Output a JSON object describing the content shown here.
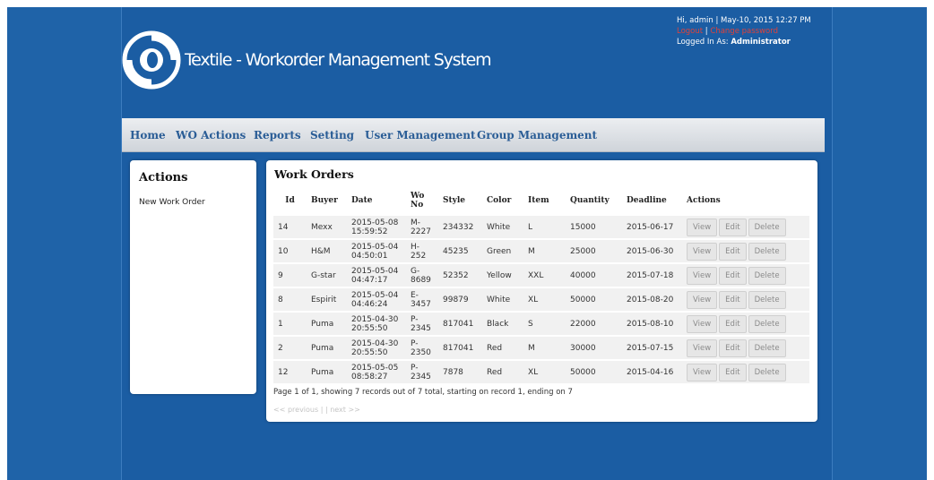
{
  "header": {
    "site_title": "Textile - Workorder Management System",
    "greeting": "Hi, admin | May-10, 2015 12:27 PM",
    "logout": "Logout",
    "change_password": "Change password",
    "logged_in_label": "Logged In As: ",
    "logged_in_role": "Administrator"
  },
  "nav": {
    "items": [
      "Home",
      "WO Actions",
      "Reports",
      "Setting",
      "User Management",
      "Group Management"
    ]
  },
  "sidebar": {
    "title": "Actions",
    "new_work_order": "New Work Order"
  },
  "work_orders": {
    "title": "Work Orders",
    "columns": [
      "Id",
      "Buyer",
      "Date",
      "Wo No",
      "Style",
      "Color",
      "Item",
      "Quantity",
      "Deadline",
      "Actions"
    ],
    "button_labels": {
      "view": "View",
      "edit": "Edit",
      "delete": "Delete"
    },
    "rows": [
      {
        "id": "14",
        "buyer": "Mexx",
        "date": "2015-05-08 15:59:52",
        "wo_no": "M-2227",
        "style": "234332",
        "color": "White",
        "item": "L",
        "quantity": "15000",
        "deadline": "2015-06-17"
      },
      {
        "id": "10",
        "buyer": "H&M",
        "date": "2015-05-04 04:50:01",
        "wo_no": "H-252",
        "style": "45235",
        "color": "Green",
        "item": "M",
        "quantity": "25000",
        "deadline": "2015-06-30"
      },
      {
        "id": "9",
        "buyer": "G-star",
        "date": "2015-05-04 04:47:17",
        "wo_no": "G-8689",
        "style": "52352",
        "color": "Yellow",
        "item": "XXL",
        "quantity": "40000",
        "deadline": "2015-07-18"
      },
      {
        "id": "8",
        "buyer": "Espirit",
        "date": "2015-05-04 04:46:24",
        "wo_no": "E-3457",
        "style": "99879",
        "color": "White",
        "item": "XL",
        "quantity": "50000",
        "deadline": "2015-08-20"
      },
      {
        "id": "1",
        "buyer": "Puma",
        "date": "2015-04-30 20:55:50",
        "wo_no": "P-2345",
        "style": "817041",
        "color": "Black",
        "item": "S",
        "quantity": "22000",
        "deadline": "2015-08-10"
      },
      {
        "id": "2",
        "buyer": "Puma",
        "date": "2015-04-30 20:55:50",
        "wo_no": "P-2350",
        "style": "817041",
        "color": "Red",
        "item": "M",
        "quantity": "30000",
        "deadline": "2015-07-15"
      },
      {
        "id": "12",
        "buyer": "Puma",
        "date": "2015-05-05 08:58:27",
        "wo_no": "P-2345",
        "style": "7878",
        "color": "Red",
        "item": "XL",
        "quantity": "50000",
        "deadline": "2015-04-16"
      }
    ],
    "paging_info": "Page 1 of 1, showing 7 records out of 7 total, starting on record 1, ending on 7",
    "paging_prev": "<< previous",
    "paging_sep": " |  | ",
    "paging_next": "next >>"
  }
}
